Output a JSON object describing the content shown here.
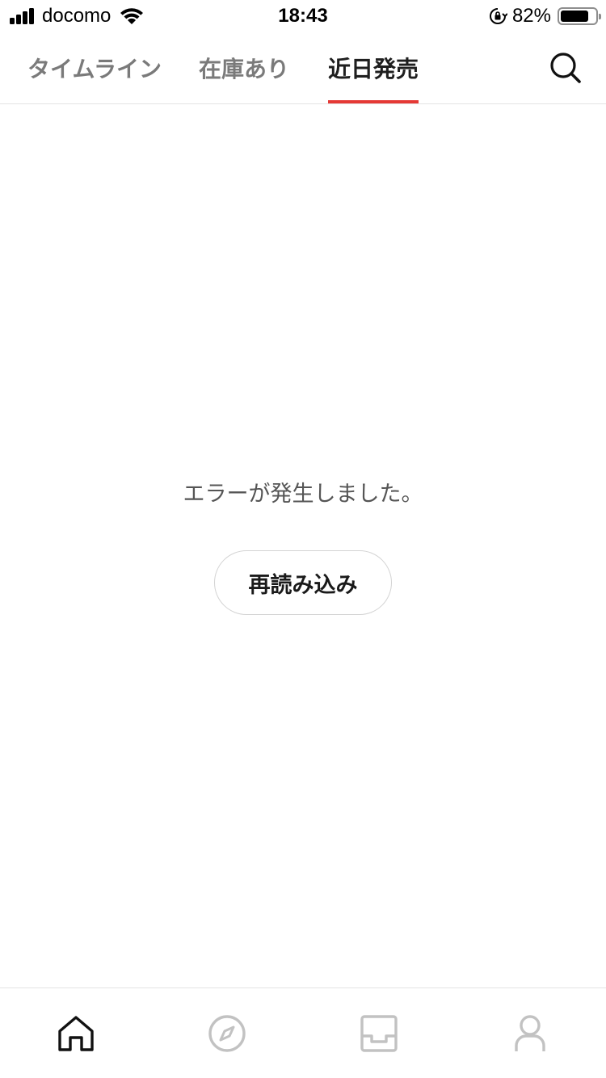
{
  "status_bar": {
    "carrier": "docomo",
    "time": "18:43",
    "battery_percent": "82%",
    "battery_level": 0.82
  },
  "tabs": [
    {
      "label": "タイムライン",
      "active": false
    },
    {
      "label": "在庫あり",
      "active": false
    },
    {
      "label": "近日発売",
      "active": true
    }
  ],
  "accent_color": "#e53935",
  "content": {
    "error_message": "エラーが発生しました。",
    "reload_label": "再読み込み"
  },
  "bottom_nav": {
    "items": [
      {
        "icon": "home-icon",
        "active": true
      },
      {
        "icon": "compass-icon",
        "active": false
      },
      {
        "icon": "inbox-icon",
        "active": false
      },
      {
        "icon": "profile-icon",
        "active": false
      }
    ]
  }
}
